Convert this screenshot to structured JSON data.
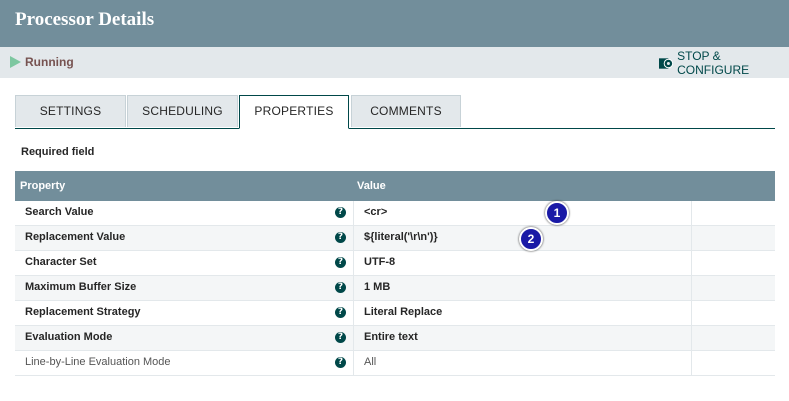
{
  "window": {
    "title": "Processor Details"
  },
  "status": {
    "state": "Running",
    "stop_configure_label": "STOP & CONFIGURE"
  },
  "tabs": [
    {
      "label": "SETTINGS",
      "active": false
    },
    {
      "label": "SCHEDULING",
      "active": false
    },
    {
      "label": "PROPERTIES",
      "active": true
    },
    {
      "label": "COMMENTS",
      "active": false
    }
  ],
  "required_note": "Required field",
  "table": {
    "headers": {
      "property": "Property",
      "value": "Value"
    },
    "rows": [
      {
        "name": "Search Value",
        "value": "<cr>",
        "required": true
      },
      {
        "name": "Replacement Value",
        "value": "${literal('\\r\\n')}",
        "required": true
      },
      {
        "name": "Character Set",
        "value": "UTF-8",
        "required": true
      },
      {
        "name": "Maximum Buffer Size",
        "value": "1 MB",
        "required": true
      },
      {
        "name": "Replacement Strategy",
        "value": "Literal Replace",
        "required": true
      },
      {
        "name": "Evaluation Mode",
        "value": "Entire text",
        "required": true
      },
      {
        "name": "Line-by-Line Evaluation Mode",
        "value": "All",
        "required": false
      }
    ]
  },
  "markers": [
    "1",
    "2"
  ],
  "icons": {
    "run": "play-icon",
    "stop_configure": "gear-stop-icon",
    "help": "help-icon"
  },
  "colors": {
    "header": "#728e9b",
    "accent": "#004849",
    "run": "#7dc7a0",
    "marker": "#1a1aa6"
  }
}
